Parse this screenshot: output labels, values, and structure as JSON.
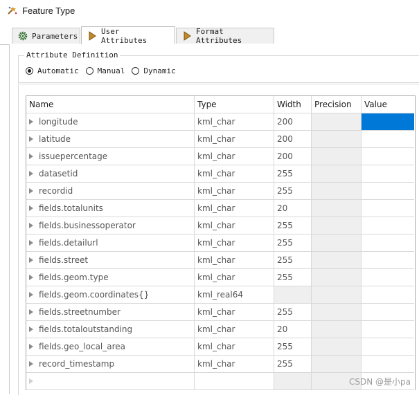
{
  "window": {
    "title": "Feature Type"
  },
  "tabs": [
    {
      "label": "Parameters",
      "icon": "gear-icon",
      "active": false
    },
    {
      "label": "User Attributes",
      "icon": "arrow-right-icon",
      "active": true
    },
    {
      "label": "Format Attributes",
      "icon": "arrow-right-icon",
      "active": false
    }
  ],
  "attribute_definition": {
    "legend": "Attribute Definition",
    "options": [
      {
        "label": "Automatic",
        "checked": true
      },
      {
        "label": "Manual",
        "checked": false
      },
      {
        "label": "Dynamic",
        "checked": false
      }
    ]
  },
  "table": {
    "columns": [
      "Name",
      "Type",
      "Width",
      "Precision",
      "Value"
    ],
    "rows": [
      {
        "name": "longitude",
        "type": "kml_char",
        "width": "200"
      },
      {
        "name": "latitude",
        "type": "kml_char",
        "width": "200"
      },
      {
        "name": "issuepercentage",
        "type": "kml_char",
        "width": "200"
      },
      {
        "name": "datasetid",
        "type": "kml_char",
        "width": "255"
      },
      {
        "name": "recordid",
        "type": "kml_char",
        "width": "255"
      },
      {
        "name": "fields.totalunits",
        "type": "kml_char",
        "width": "20"
      },
      {
        "name": "fields.businessoperator",
        "type": "kml_char",
        "width": "255"
      },
      {
        "name": "fields.detailurl",
        "type": "kml_char",
        "width": "255"
      },
      {
        "name": "fields.street",
        "type": "kml_char",
        "width": "255"
      },
      {
        "name": "fields.geom.type",
        "type": "kml_char",
        "width": "255"
      },
      {
        "name": "fields.geom.coordinates{}",
        "type": "kml_real64",
        "width": ""
      },
      {
        "name": "fields.streetnumber",
        "type": "kml_char",
        "width": "255"
      },
      {
        "name": "fields.totaloutstanding",
        "type": "kml_char",
        "width": "20"
      },
      {
        "name": "fields.geo_local_area",
        "type": "kml_char",
        "width": "255"
      },
      {
        "name": "record_timestamp",
        "type": "kml_char",
        "width": "255"
      },
      {
        "name": "",
        "type": "",
        "width": ""
      }
    ]
  },
  "watermark": "CSDN @是小pa",
  "colors": {
    "selection": "#0078d7",
    "disabled_cell": "#efefef"
  }
}
